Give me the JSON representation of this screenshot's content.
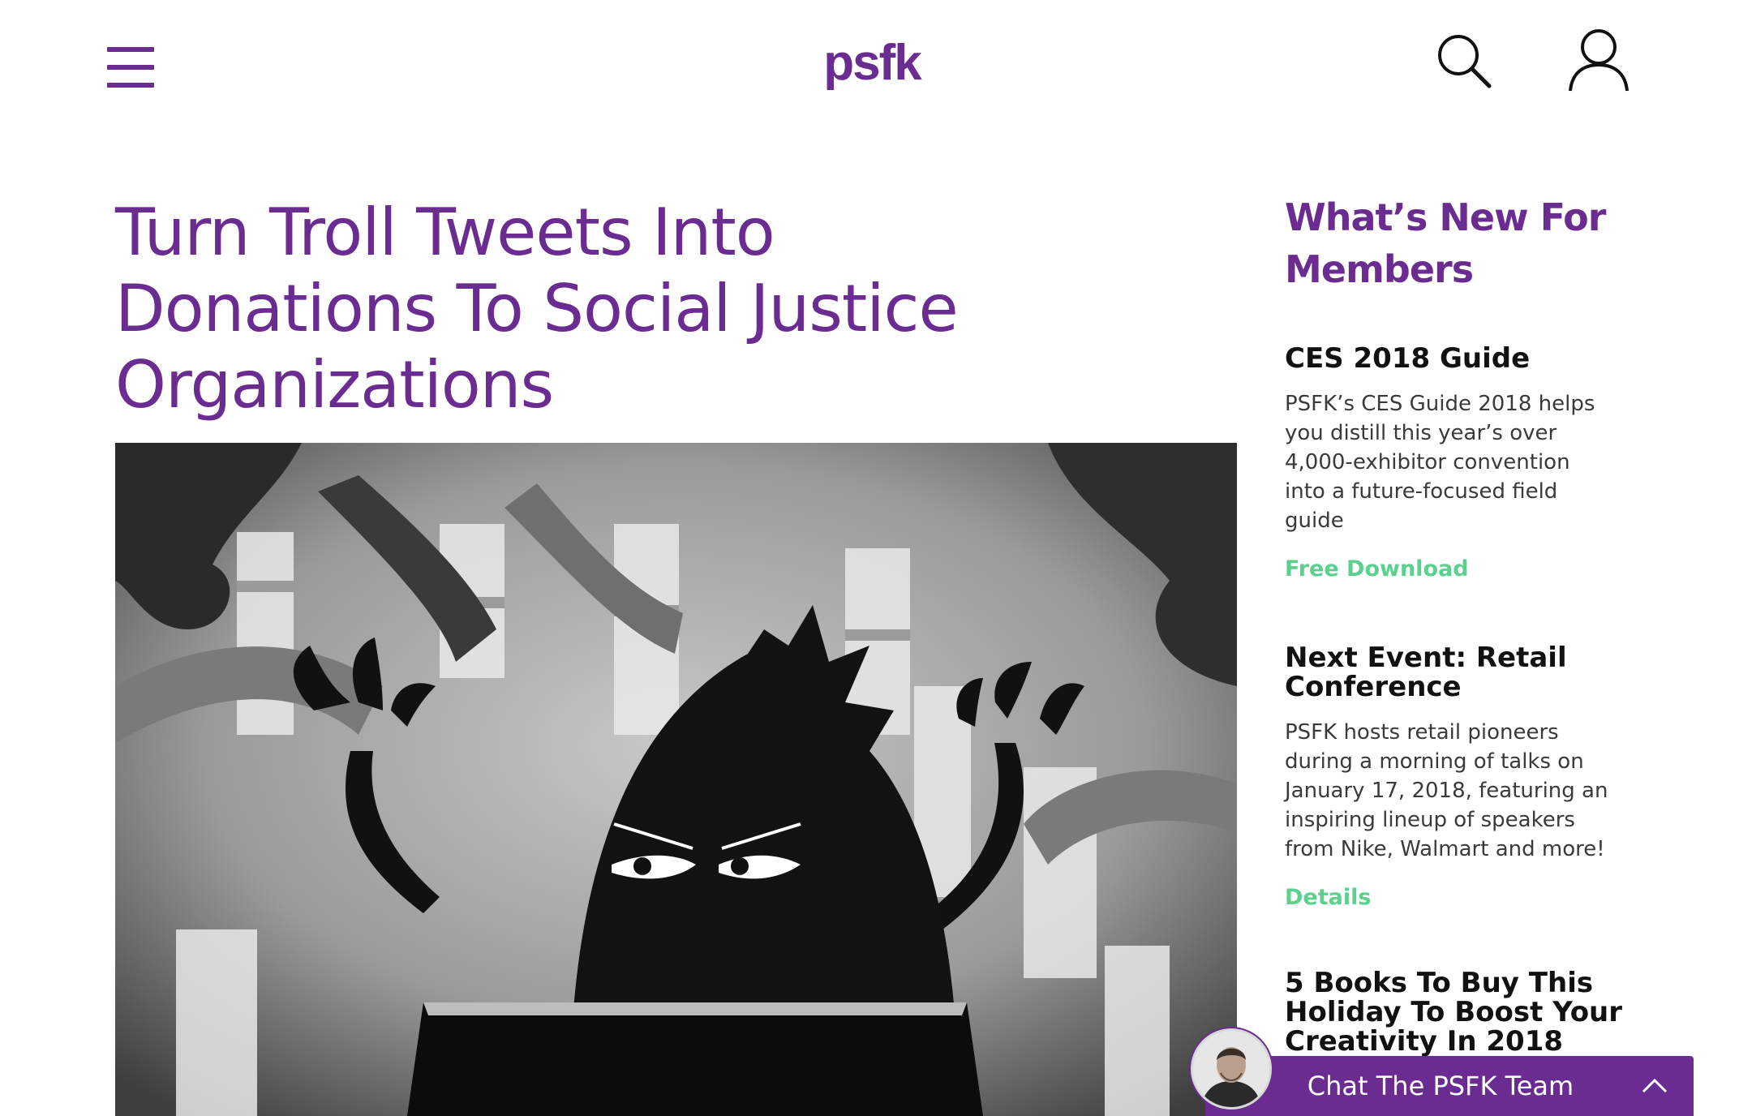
{
  "header": {
    "logo_text": "psfk",
    "icons": {
      "menu": "hamburger-menu-icon",
      "search": "search-icon",
      "account": "user-icon"
    }
  },
  "article": {
    "title_lines": [
      "Turn Troll Tweets Into",
      "Donations To Social Justice",
      "Organizations"
    ],
    "hero_image_subject": "cartoon-troll-at-laptop-illustration"
  },
  "sidebar": {
    "heading_lines": [
      "What’s New For",
      "Members"
    ],
    "items": [
      {
        "title": "CES 2018 Guide",
        "description_lines": [
          "PSFK’s CES Guide 2018 helps",
          "you distill this year’s over",
          "4,000-exhibitor convention",
          "into a future-focused field",
          "guide"
        ],
        "link": "Free Download"
      },
      {
        "title_lines": [
          "Next Event: Retail",
          "Conference"
        ],
        "description_lines": [
          "PSFK hosts retail pioneers",
          "during a morning of talks on",
          "January 17, 2018, featuring an",
          "inspiring lineup of speakers",
          "from Nike, Walmart and more!"
        ],
        "link": "Details"
      },
      {
        "title_lines": [
          "5 Books To Buy This",
          "Holiday To Boost Your",
          "Creativity In 2018"
        ]
      }
    ]
  },
  "chat": {
    "label": "Chat The PSFK Team",
    "chevron_icon": "chevron-up-icon"
  },
  "colors": {
    "brand_purple": "#6b2c91",
    "link_green": "#5cd18f",
    "heading_black": "#111111",
    "body_text": "#3a3a3a"
  }
}
